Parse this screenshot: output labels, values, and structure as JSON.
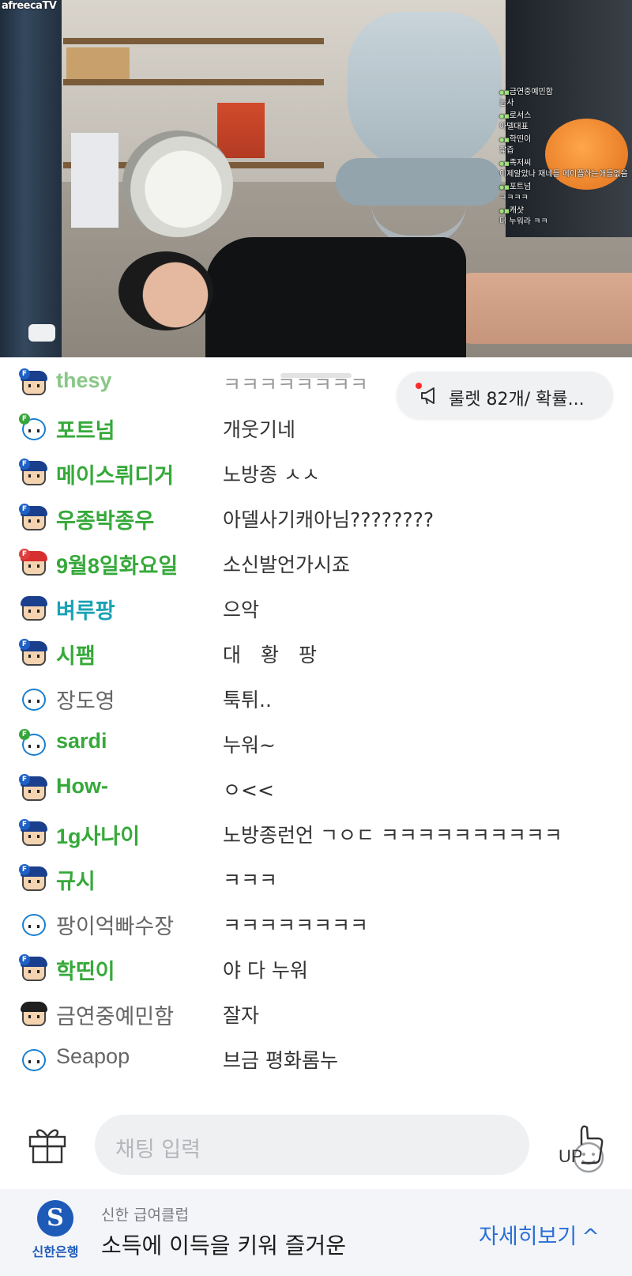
{
  "stream": {
    "logo": "afreecaTV",
    "overlay_chat": [
      {
        "name": "금연중예민함",
        "msg": "눕사"
      },
      {
        "name": "로서스",
        "msg": "아델대표"
      },
      {
        "name": "학띤이",
        "msg": "짧즙"
      },
      {
        "name": "족저씨",
        "msg": "이제알았나 재네들 메이플하는애들없음"
      },
      {
        "name": "포트넘",
        "msg": "ㅋㅋㅋㅋ"
      },
      {
        "name": "캐샷",
        "msg": "더 누워라 ㅋㅋ"
      }
    ]
  },
  "roulette": {
    "text": "룰렛 82개/ 확률...",
    "icon": "megaphone-icon"
  },
  "chat": {
    "messages": [
      {
        "name": "thesy",
        "msg": "ㅋㅋㅋㅋㅋㅋㅋㅋ",
        "style": "faded",
        "avatar": "fan-blue",
        "badge": "F"
      },
      {
        "name": "포트넘",
        "msg": "개웃기네",
        "style": "green",
        "avatar": "bear",
        "badge": "F"
      },
      {
        "name": "메이스뤼디거",
        "msg": "노방종 ㅅㅅ",
        "style": "green",
        "avatar": "fan-blue",
        "badge": "F"
      },
      {
        "name": "우종박종우",
        "msg": "아델사기캐아님????????",
        "style": "green",
        "avatar": "fan-blue",
        "badge": "F"
      },
      {
        "name": "9월8일화요일",
        "msg": "소신발언가시죠",
        "style": "green",
        "avatar": "fan-red",
        "badge": "F"
      },
      {
        "name": "벼루팡",
        "msg": "으악",
        "style": "teal",
        "avatar": "fan-blue",
        "badge": ""
      },
      {
        "name": "시팸",
        "msg": "대　황　팡",
        "style": "green",
        "avatar": "fan-blue",
        "badge": "F"
      },
      {
        "name": "장도영",
        "msg": "툭튀..",
        "style": "gray",
        "avatar": "bear",
        "badge": ""
      },
      {
        "name": "sardi",
        "msg": "누워~",
        "style": "green",
        "avatar": "bear",
        "badge": "F"
      },
      {
        "name": "How-",
        "msg": "ㅇ<<",
        "style": "green",
        "avatar": "fan-blue",
        "badge": "F"
      },
      {
        "name": "1g사나이",
        "msg": "노방종런언 ㄱㅇㄷ ㅋㅋㅋㅋㅋㅋㅋㅋㅋㅋ",
        "style": "green",
        "avatar": "fan-blue",
        "badge": "F"
      },
      {
        "name": "규시",
        "msg": "ㅋㅋㅋ",
        "style": "green",
        "avatar": "fan-blue",
        "badge": "F"
      },
      {
        "name": "팡이억빠수장",
        "msg": "ㅋㅋㅋㅋㅋㅋㅋㅋ",
        "style": "gray",
        "avatar": "bear",
        "badge": ""
      },
      {
        "name": "학띤이",
        "msg": "야 다 누워",
        "style": "green",
        "avatar": "fan-blue",
        "badge": "F"
      },
      {
        "name": "금연중예민함",
        "msg": "잘자",
        "style": "gray",
        "avatar": "fan-black",
        "badge": ""
      },
      {
        "name": "Seapop",
        "msg": "브금 평화롬누",
        "style": "gray",
        "avatar": "bear",
        "badge": ""
      }
    ]
  },
  "input": {
    "placeholder": "채팅 입력",
    "gift_icon": "gift-icon",
    "emoji_icon": "emoji-icon",
    "up_label": "UP",
    "up_icon": "thumbs-up-icon"
  },
  "ad": {
    "brand": "신한은행",
    "subtitle": "신한 급여클럽",
    "title": "소득에 이득을 키워 즐거운",
    "more": "자세히보기",
    "colors": {
      "brand": "#1e5bb8",
      "link": "#2a6fd6"
    }
  },
  "colors": {
    "name_green": "#36a93a",
    "name_teal": "#19a2b4",
    "name_gray": "#666666"
  }
}
